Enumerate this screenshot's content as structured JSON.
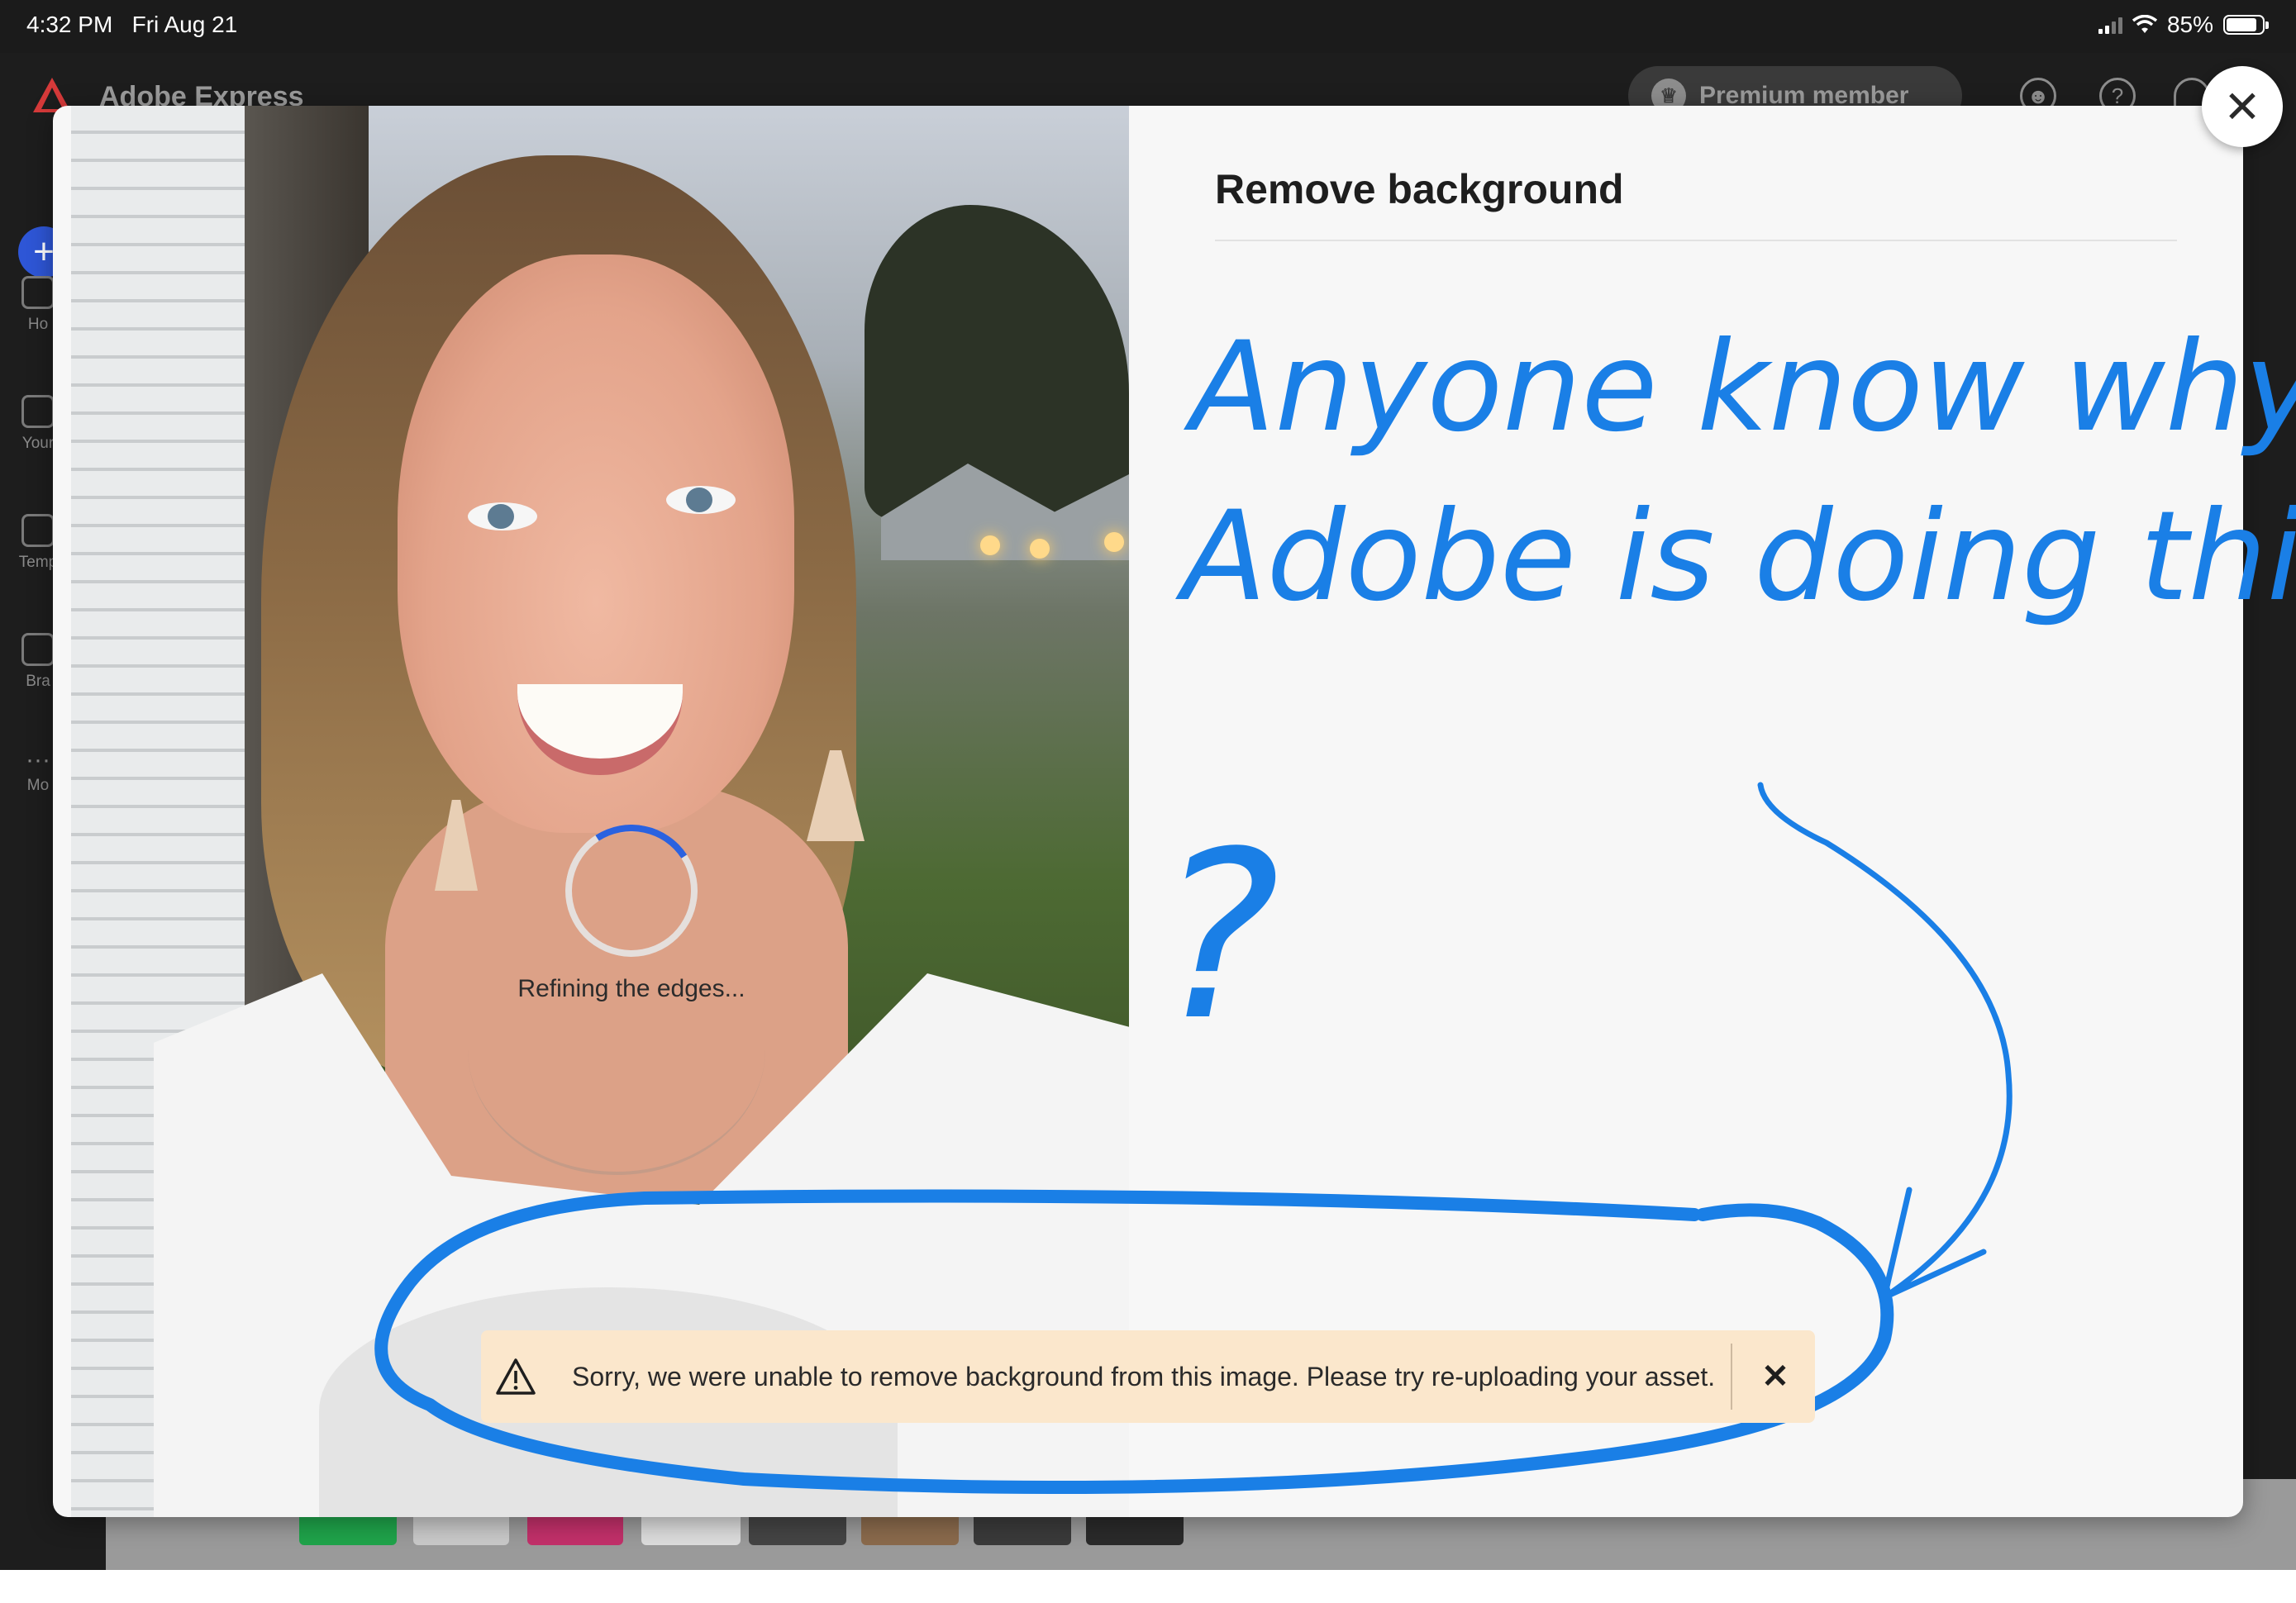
{
  "status_bar": {
    "time": "4:32 PM",
    "date": "Fri Aug 21",
    "battery": "85%",
    "battery_level": 0.85
  },
  "app": {
    "title": "Adobe Express",
    "premium_label": "Premium member",
    "nav": [
      {
        "label": "Ho",
        "icon": "home-icon"
      },
      {
        "label": "Your",
        "icon": "file-icon"
      },
      {
        "label": "Temp",
        "icon": "template-icon"
      },
      {
        "label": "Bra",
        "icon": "brand-icon"
      },
      {
        "label": "Mo",
        "icon": "more-icon"
      }
    ],
    "header_icons": [
      "people-icon",
      "help-icon",
      "bell-icon"
    ]
  },
  "modal": {
    "title": "Remove background",
    "progress_label": "Refining the edges...",
    "close_icon": "close-icon"
  },
  "annotation": {
    "handwritten_text": "Anyone know why Adobe is doing this?",
    "question_mark": "?",
    "ink_color": "#1a7fe6"
  },
  "toast": {
    "message": "Sorry, we were unable to remove background from this image. Please try re-uploading your asset.",
    "warning_icon": "warning-icon",
    "close_icon": "close-icon",
    "background": "#fbe7cc"
  },
  "colors": {
    "accent": "#2a62e0",
    "panel_bg": "#f7f7f7"
  }
}
